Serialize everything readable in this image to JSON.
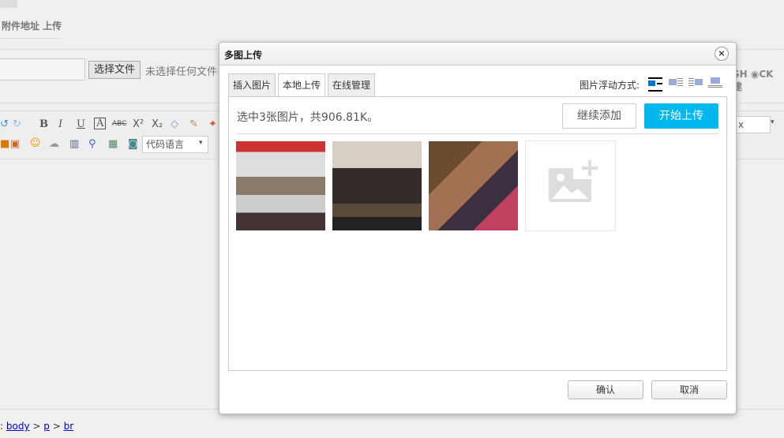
{
  "background": {
    "section_title": "附件地址 上传",
    "file_button": "选择文件",
    "no_file": "未选择任何文件",
    "code_language": "代码语言",
    "right_text": "SH ◉CK 建",
    "right_select": "x",
    "breadcrumb": {
      "prefix": ":",
      "items": [
        "body",
        "p",
        "br"
      ],
      "sep": ">"
    }
  },
  "dialog": {
    "title": "多图上传",
    "close": "×",
    "tabs": [
      "插入图片",
      "本地上传",
      "在线管理"
    ],
    "active_tab": 1,
    "float_label": "图片浮动方式:",
    "info": "选中3张图片，共906.81K。",
    "continue_button": "继续添加",
    "upload_button": "开始上传",
    "confirm": "确认",
    "cancel": "取消",
    "accent": "#00b7ee"
  }
}
